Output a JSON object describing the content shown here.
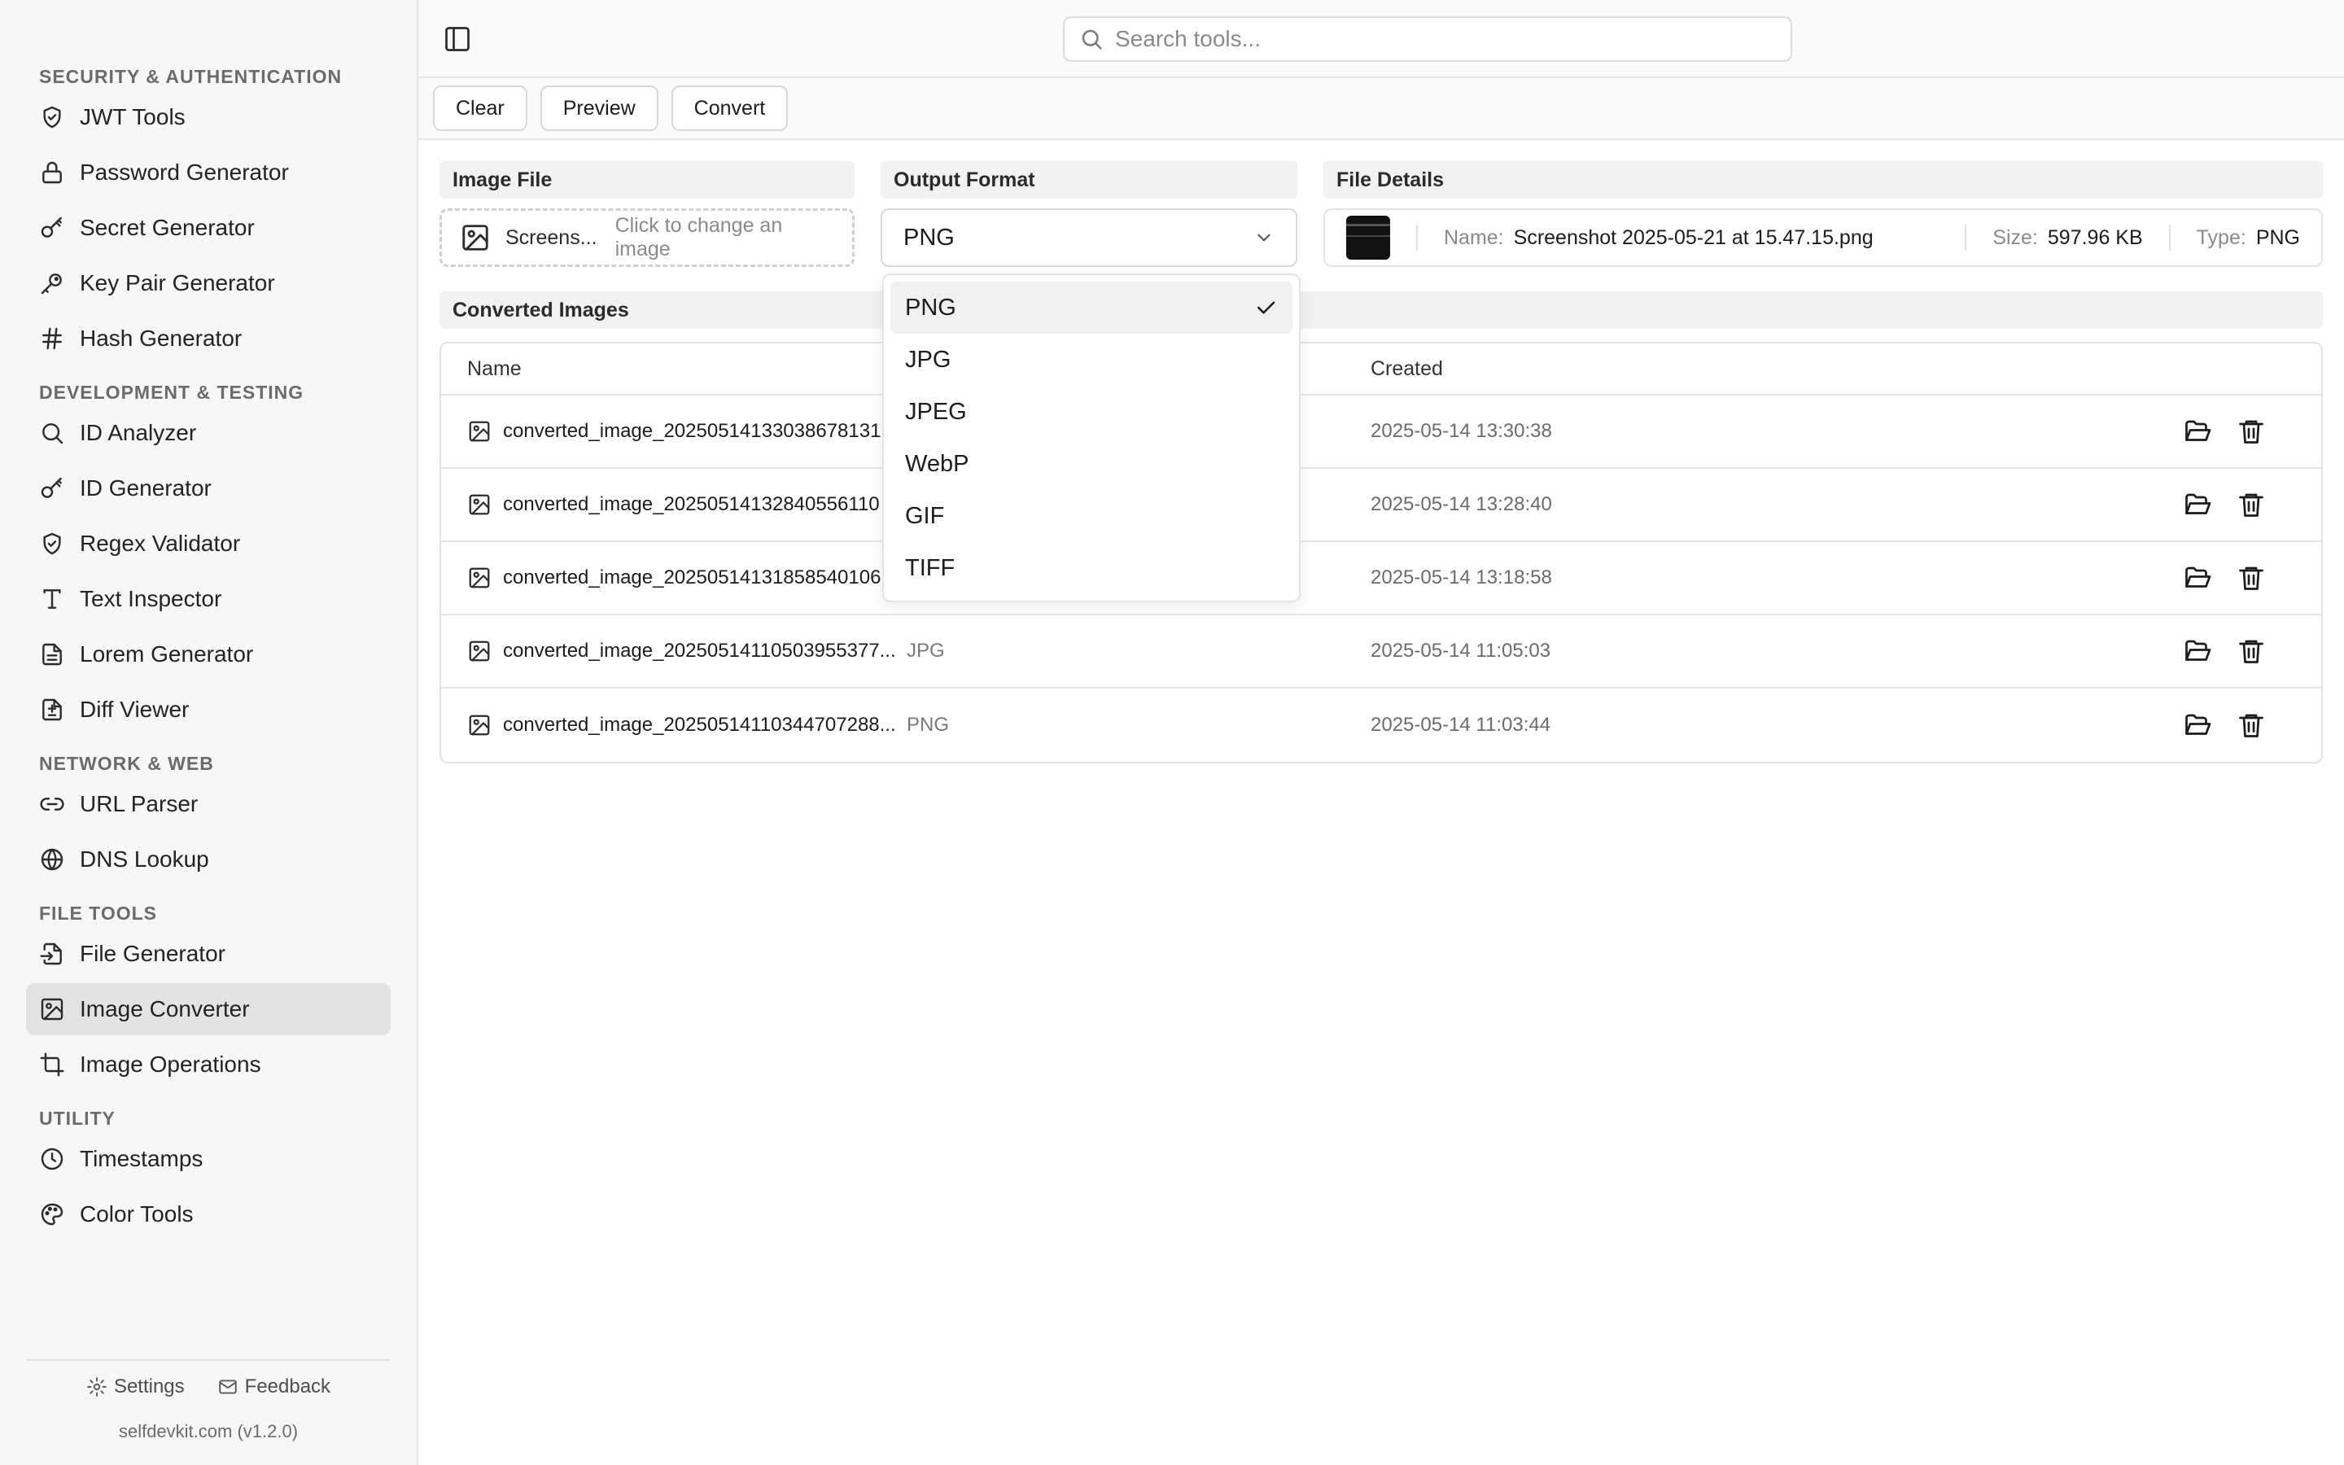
{
  "sidebar": {
    "sections": [
      {
        "title": "SECURITY & AUTHENTICATION",
        "items": [
          {
            "label": "JWT Tools",
            "icon": "shield-check-icon"
          },
          {
            "label": "Password Generator",
            "icon": "lock-icon"
          },
          {
            "label": "Secret Generator",
            "icon": "key-icon"
          },
          {
            "label": "Key Pair Generator",
            "icon": "key-round-icon"
          },
          {
            "label": "Hash Generator",
            "icon": "hash-icon"
          }
        ]
      },
      {
        "title": "DEVELOPMENT & TESTING",
        "items": [
          {
            "label": "ID Analyzer",
            "icon": "search-icon"
          },
          {
            "label": "ID Generator",
            "icon": "key-icon"
          },
          {
            "label": "Regex Validator",
            "icon": "shield-check-icon"
          },
          {
            "label": "Text Inspector",
            "icon": "type-icon"
          },
          {
            "label": "Lorem Generator",
            "icon": "file-text-icon"
          },
          {
            "label": "Diff Viewer",
            "icon": "file-diff-icon"
          }
        ]
      },
      {
        "title": "NETWORK & WEB",
        "items": [
          {
            "label": "URL Parser",
            "icon": "link-icon"
          },
          {
            "label": "DNS Lookup",
            "icon": "globe-icon"
          }
        ]
      },
      {
        "title": "FILE TOOLS",
        "items": [
          {
            "label": "File Generator",
            "icon": "file-input-icon"
          },
          {
            "label": "Image Converter",
            "icon": "image-icon",
            "active": true
          },
          {
            "label": "Image Operations",
            "icon": "crop-icon"
          }
        ]
      },
      {
        "title": "UTILITY",
        "items": [
          {
            "label": "Timestamps",
            "icon": "clock-icon"
          },
          {
            "label": "Color Tools",
            "icon": "palette-icon"
          }
        ]
      }
    ],
    "footer": {
      "settings_label": "Settings",
      "feedback_label": "Feedback",
      "version": "selfdevkit.com (v1.2.0)"
    }
  },
  "header": {
    "search_placeholder": "Search tools..."
  },
  "toolbar": {
    "clear_label": "Clear",
    "preview_label": "Preview",
    "convert_label": "Convert"
  },
  "image_file": {
    "label": "Image File",
    "file_name": "Screens...",
    "hint": "Click to change an image"
  },
  "output_format": {
    "label": "Output Format",
    "selected": "PNG",
    "options": [
      "PNG",
      "JPG",
      "JPEG",
      "WebP",
      "GIF",
      "TIFF"
    ]
  },
  "file_details": {
    "label": "File Details",
    "name_label": "Name:",
    "name_value": "Screenshot 2025-05-21 at 15.47.15.png",
    "size_label": "Size:",
    "size_value": "597.96 KB",
    "type_label": "Type:",
    "type_value": "PNG"
  },
  "converted": {
    "label": "Converted Images",
    "columns": {
      "name": "Name",
      "created": "Created"
    },
    "rows": [
      {
        "name": "converted_image_20250514133038678131",
        "type": "",
        "created": "2025-05-14 13:30:38"
      },
      {
        "name": "converted_image_20250514132840556110",
        "type": "",
        "created": "2025-05-14 13:28:40"
      },
      {
        "name": "converted_image_20250514131858540106",
        "type": "",
        "created": "2025-05-14 13:18:58"
      },
      {
        "name": "converted_image_20250514110503955377...",
        "type": "JPG",
        "created": "2025-05-14 11:05:03"
      },
      {
        "name": "converted_image_20250514110344707288...",
        "type": "PNG",
        "created": "2025-05-14 11:03:44"
      }
    ]
  }
}
